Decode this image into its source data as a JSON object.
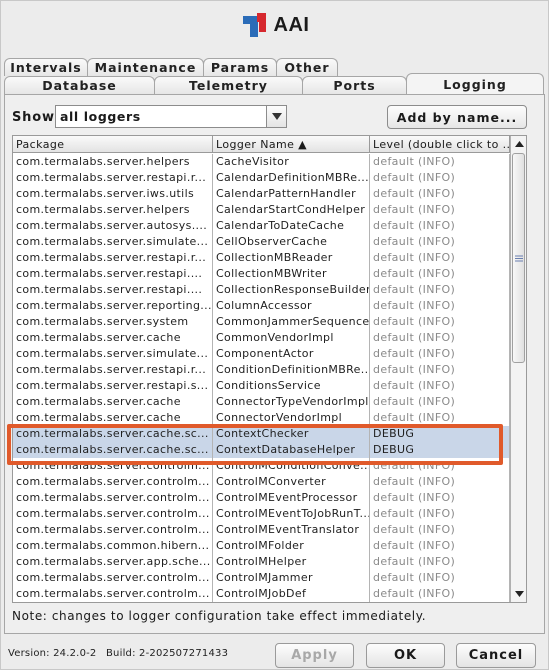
{
  "app": {
    "title": "AAI"
  },
  "tabs": {
    "back": [
      "Intervals",
      "Maintenance",
      "Params",
      "Other"
    ],
    "front": [
      "Database",
      "Telemetry",
      "Ports",
      "Logging"
    ],
    "active": "Logging"
  },
  "toolbar": {
    "show_label": "Show",
    "filter_value": "all loggers",
    "add_button": "Add by name..."
  },
  "table": {
    "columns": [
      "Package",
      "Logger Name ▲",
      "Level (double click to ..."
    ],
    "rows": [
      {
        "package": "com.termalabs.server.helpers",
        "logger": "CacheVisitor",
        "level": "default (INFO)"
      },
      {
        "package": "com.termalabs.server.restapi.r...",
        "logger": "CalendarDefinitionMBRe...",
        "level": "default (INFO)"
      },
      {
        "package": "com.termalabs.server.iws.utils",
        "logger": "CalendarPatternHandler",
        "level": "default (INFO)"
      },
      {
        "package": "com.termalabs.server.helpers",
        "logger": "CalendarStartCondHelper",
        "level": "default (INFO)"
      },
      {
        "package": "com.termalabs.server.autosys....",
        "logger": "CalendarToDateCache",
        "level": "default (INFO)"
      },
      {
        "package": "com.termalabs.server.simulate...",
        "logger": "CellObserverCache",
        "level": "default (INFO)"
      },
      {
        "package": "com.termalabs.server.restapi.r...",
        "logger": "CollectionMBReader",
        "level": "default (INFO)"
      },
      {
        "package": "com.termalabs.server.restapi....",
        "logger": "CollectionMBWriter",
        "level": "default (INFO)"
      },
      {
        "package": "com.termalabs.server.restapi....",
        "logger": "CollectionResponseBuilder",
        "level": "default (INFO)"
      },
      {
        "package": "com.termalabs.server.reporting...",
        "logger": "ColumnAccessor",
        "level": "default (INFO)"
      },
      {
        "package": "com.termalabs.server.system",
        "logger": "CommonJammerSequence",
        "level": "default (INFO)"
      },
      {
        "package": "com.termalabs.server.cache",
        "logger": "CommonVendorImpl",
        "level": "default (INFO)"
      },
      {
        "package": "com.termalabs.server.simulate...",
        "logger": "ComponentActor",
        "level": "default (INFO)"
      },
      {
        "package": "com.termalabs.server.restapi.r...",
        "logger": "ConditionDefinitionMBRe...",
        "level": "default (INFO)"
      },
      {
        "package": "com.termalabs.server.restapi.s...",
        "logger": "ConditionsService",
        "level": "default (INFO)"
      },
      {
        "package": "com.termalabs.server.cache",
        "logger": "ConnectorTypeVendorImpl",
        "level": "default (INFO)"
      },
      {
        "package": "com.termalabs.server.cache",
        "logger": "ConnectorVendorImpl",
        "level": "default (INFO)"
      },
      {
        "package": "com.termalabs.server.cache.sc...",
        "logger": "ContextChecker",
        "level": "DEBUG"
      },
      {
        "package": "com.termalabs.server.cache.sc...",
        "logger": "ContextDatabaseHelper",
        "level": "DEBUG"
      },
      {
        "package": "com.termalabs.server.controlm...",
        "logger": "ControlMConditionConve...",
        "level": "default (INFO)"
      },
      {
        "package": "com.termalabs.server.controlm...",
        "logger": "ControlMConverter",
        "level": "default (INFO)"
      },
      {
        "package": "com.termalabs.server.controlm...",
        "logger": "ControlMEventProcessor",
        "level": "default (INFO)"
      },
      {
        "package": "com.termalabs.server.controlm...",
        "logger": "ControlMEventToJobRunT...",
        "level": "default (INFO)"
      },
      {
        "package": "com.termalabs.server.controlm...",
        "logger": "ControlMEventTranslator",
        "level": "default (INFO)"
      },
      {
        "package": "com.termalabs.common.hibern...",
        "logger": "ControlMFolder",
        "level": "default (INFO)"
      },
      {
        "package": "com.termalabs.server.app.sche...",
        "logger": "ControlMHelper",
        "level": "default (INFO)"
      },
      {
        "package": "com.termalabs.server.controlm...",
        "logger": "ControlMJammer",
        "level": "default (INFO)"
      },
      {
        "package": "com.termalabs.server.controlm...",
        "logger": "ControlMJobDef",
        "level": "default (INFO)"
      }
    ]
  },
  "note": "Note: changes to logger configuration take effect immediately.",
  "footer": {
    "version": "Version: 24.2.0-2",
    "build": "Build: 2-202507271433",
    "apply": "Apply",
    "ok": "OK",
    "cancel": "Cancel"
  },
  "colors": {
    "logo_blue": "#2b6cb8",
    "logo_red": "#d6282e",
    "highlight": "#e05a2b",
    "selection": "#c9d6e8"
  }
}
